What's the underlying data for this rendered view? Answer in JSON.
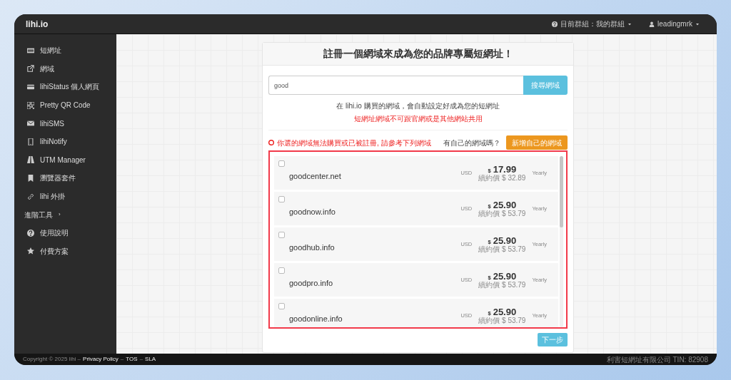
{
  "brand": "lihi.io",
  "top_menu": [
    {
      "kind": "group",
      "label": "目前群組：我的群組"
    },
    {
      "kind": "user",
      "label": "leadingmrk"
    }
  ],
  "sidebar": {
    "items": [
      {
        "kind": "link",
        "label": "短網址"
      },
      {
        "kind": "link",
        "label": "網域"
      },
      {
        "kind": "link",
        "label": "lihiStatus 個人網頁"
      },
      {
        "kind": "link",
        "label": "Pretty QR Code"
      },
      {
        "kind": "link",
        "label": "lihiSMS"
      },
      {
        "kind": "link",
        "label": "lihiNotify"
      },
      {
        "kind": "link",
        "label": "UTM Manager"
      },
      {
        "kind": "link",
        "label": "瀏覽器套件"
      },
      {
        "kind": "link",
        "label": "lihi 外掛"
      },
      {
        "kind": "section",
        "label": "進階工具",
        "arrow": "›"
      },
      {
        "kind": "link",
        "label": "使用說明"
      },
      {
        "kind": "link",
        "label": "付費方案"
      }
    ]
  },
  "card": {
    "title": "註冊一個網域來成為您的品牌專屬短網址！",
    "search": {
      "value": "good",
      "button": "搜尋網域"
    },
    "info": "在 lihi.io 購買的網域，會自動設定好成為您的短網址",
    "warning": "短網址網域不可跟官網或是其他網站共用",
    "error": "你選的網域無法購買或已被註冊, 請參考下列網域",
    "own_domain_prompt": "有自己的網域嗎？",
    "own_domain_button": "新增自己的網域",
    "domains": [
      {
        "name": "goodcenter.net",
        "checked": false,
        "currency": "USD",
        "symbol": "$",
        "price": "17.99",
        "period": "Yearly",
        "renewal": "續約價 $ 32.89"
      },
      {
        "name": "goodnow.info",
        "checked": false,
        "currency": "USD",
        "symbol": "$",
        "price": "25.90",
        "period": "Yearly",
        "renewal": "續約價 $ 53.79"
      },
      {
        "name": "goodhub.info",
        "checked": false,
        "currency": "USD",
        "symbol": "$",
        "price": "25.90",
        "period": "Yearly",
        "renewal": "續約價 $ 53.79"
      },
      {
        "name": "goodpro.info",
        "checked": false,
        "currency": "USD",
        "symbol": "$",
        "price": "25.90",
        "period": "Yearly",
        "renewal": "續約價 $ 53.79"
      },
      {
        "name": "goodonline.info",
        "checked": false,
        "currency": "USD",
        "symbol": "$",
        "price": "25.90",
        "period": "Yearly",
        "renewal": "續約價 $ 53.79"
      }
    ],
    "next_button": "下一步"
  },
  "footer": {
    "copyright": "Copyright © 2025 lihi –",
    "links": [
      "Privacy Policy",
      "TOS",
      "SLA"
    ],
    "separator": "–",
    "company": "利害短網址有限公司 TIN: 82908"
  }
}
